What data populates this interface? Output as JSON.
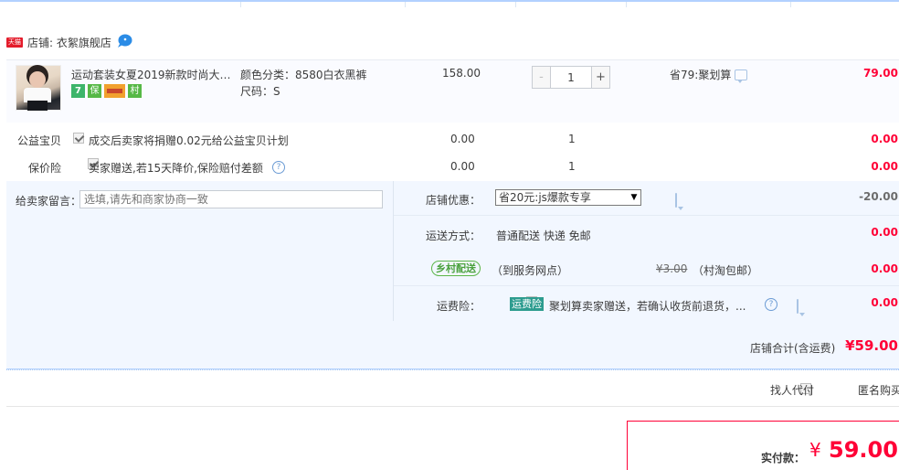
{
  "shop": {
    "badge": "天猫",
    "label": "店铺: 衣絮旗舰店"
  },
  "item": {
    "title": "运动套装女夏2019新款时尚大…",
    "icons": [
      "7",
      "保",
      "",
      "村"
    ],
    "sku_color": "颜色分类：8580白衣黑裤",
    "sku_size": "尺码：S",
    "price": "158.00",
    "qty_minus": "-",
    "qty_value": "1",
    "qty_plus": "+",
    "promo": "省79:聚划算",
    "subtotal": "79.00"
  },
  "charity": {
    "label": "公益宝贝",
    "text": "成交后卖家将捐赠0.02元给公益宝贝计划",
    "price": "0.00",
    "qty": "1",
    "subtotal": "0.00"
  },
  "price_protect": {
    "label": "保价险",
    "text": "卖家赠送,若15天降价,保险赔付差额",
    "price": "0.00",
    "qty": "1",
    "subtotal": "0.00",
    "help": "?"
  },
  "message": {
    "label": "给卖家留言：",
    "placeholder": "选填,请先和商家协商一致"
  },
  "shop_discount": {
    "label": "店铺优惠：",
    "selected": "省20元:js爆款专享",
    "amount": "-20.00"
  },
  "shipping": {
    "label": "运送方式：",
    "method": "普通配送 快递 免邮",
    "amount": "0.00",
    "village_badge": "乡村配送",
    "village_text": "（到服务网点）",
    "village_fee": "¥3.00",
    "village_note": "（村淘包邮）",
    "village_amount": "0.00"
  },
  "ship_insurance": {
    "label": "运费险：",
    "badge": "运费险",
    "text": "聚划算卖家赠送，若确认收货前退货，...",
    "amount": "0.00"
  },
  "shop_total": {
    "label": "店铺合计(含运费)",
    "amount": "¥59.00"
  },
  "options": {
    "proxy": "找人代付",
    "anonymous": "匿名购买"
  },
  "payment": {
    "label": "实付款：",
    "currency": "¥",
    "amount": "59.00"
  },
  "colors": {
    "accent_red": "#ff0036",
    "border_blue": "#b2d1ff",
    "panel_bg": "#f2f7ff",
    "village_green": "#5bb548"
  }
}
